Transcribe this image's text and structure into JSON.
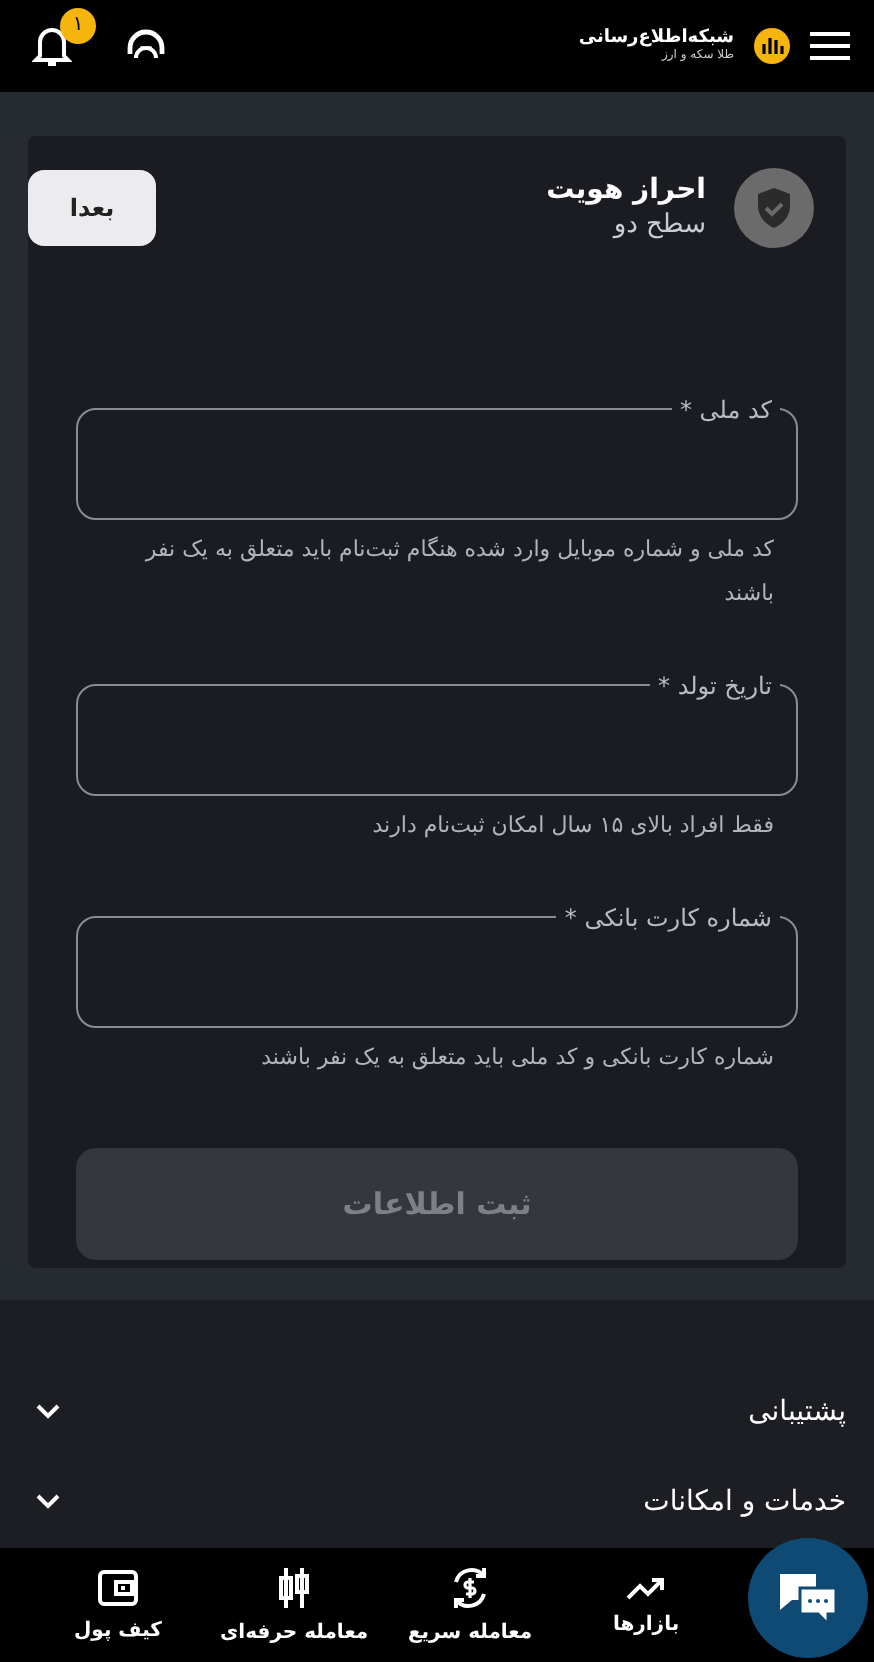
{
  "header": {
    "logo_title": "شبکه‌اطلاع‌رسانی",
    "logo_subtitle": "طلا سکه و ارز",
    "notification_count": "۱"
  },
  "card": {
    "title": "احراز هویت",
    "subtitle": "سطح دو",
    "later_button": "بعدا",
    "fields": [
      {
        "label": "کد ملی *",
        "helper": "کد ملی و شماره موبایل وارد شده هنگام ثبت‌نام باید متعلق به یک نفر باشند"
      },
      {
        "label": "تاریخ تولد *",
        "helper": "فقط افراد بالای ۱۵ سال امکان ثبت‌نام دارند"
      },
      {
        "label": "شماره کارت بانکی *",
        "helper": "شماره کارت بانکی و کد ملی باید متعلق به یک نفر باشند"
      }
    ],
    "submit": {
      "label": "ثبت اطلاعات",
      "disabled": true
    }
  },
  "accordion": [
    {
      "label": "پشتیبانی",
      "expanded": false
    },
    {
      "label": "خدمات و امکانات",
      "expanded": false
    }
  ],
  "bottom_nav": [
    {
      "label": "بازارها",
      "kind": "trend"
    },
    {
      "label": "معامله سریع",
      "kind": "exchange"
    },
    {
      "label": "معامله حرفه‌ای",
      "kind": "candles"
    },
    {
      "label": "کیف پول",
      "kind": "wallet"
    }
  ]
}
